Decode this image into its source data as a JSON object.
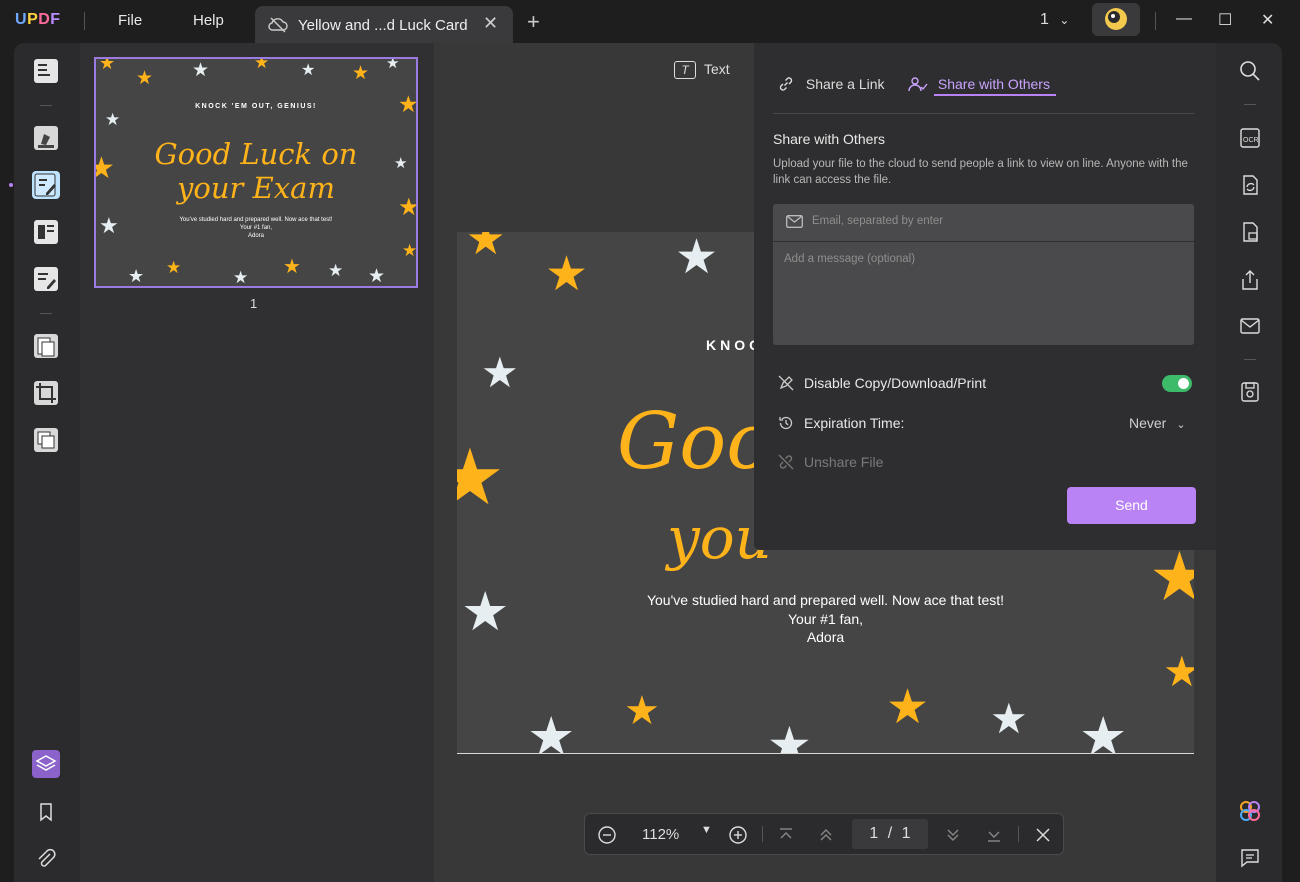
{
  "app": {
    "logo": {
      "u": "U",
      "p": "P",
      "d": "D",
      "f": "F"
    },
    "menu": {
      "file": "File",
      "help": "Help"
    },
    "tab": {
      "title": "Yellow and ...d Luck Card",
      "close": "✕"
    },
    "new_tab": "+",
    "page_selector": "1",
    "window": {
      "minimize": "—",
      "maximize": "☐",
      "close": "✕"
    }
  },
  "thumbnail": {
    "page_label": "1"
  },
  "card": {
    "heading": "KNOCK 'EM OUT, GENIUS!",
    "script_line1": "Good Luck on",
    "script_line2": "your Exam",
    "body_line1": "You've studied hard and prepared well. Now ace that test!",
    "body_line2": "Your #1 fan,",
    "body_line3": "Adora",
    "doc_heading_partial": "KNOC",
    "doc_script_partial1": "Good",
    "doc_script_partial2": "you"
  },
  "doc_toolbar": {
    "text_tool": "Text"
  },
  "share": {
    "tabs": {
      "share_link": "Share a Link",
      "share_others": "Share with Others"
    },
    "section_title": "Share with Others",
    "description": "Upload your file to the cloud to send people a link to view on line. Anyone with the link can access the file.",
    "email_placeholder": "Email, separated by enter",
    "message_placeholder": "Add a message (optional)",
    "disable_label": "Disable Copy/Download/Print",
    "disable_on": true,
    "expiration_label": "Expiration Time:",
    "expiration_value": "Never",
    "unshare_label": "Unshare File",
    "send_label": "Send"
  },
  "bottom": {
    "zoom": "112%",
    "page_current": "1",
    "page_sep": "/",
    "page_total": "1"
  },
  "colors": {
    "accent": "#b983f5",
    "toggle_on": "#3dba6a",
    "star_yellow": "#ffb31a",
    "star_white": "#e6eef2"
  }
}
